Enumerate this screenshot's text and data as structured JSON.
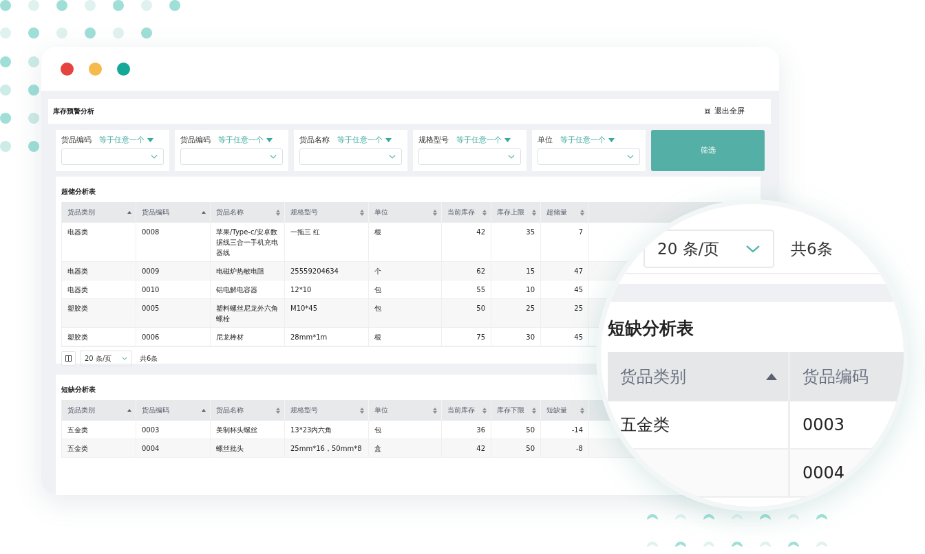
{
  "window": {
    "traffic_lights": [
      {
        "color": "#e5433f"
      },
      {
        "color": "#f6b94c"
      },
      {
        "color": "#14a898"
      }
    ]
  },
  "header": {
    "title": "库存预警分析",
    "exit_fullscreen": "退出全屏"
  },
  "filters": [
    {
      "label": "货品编码",
      "operator": "等于任意一个"
    },
    {
      "label": "货品编码",
      "operator": "等于任意一个"
    },
    {
      "label": "货品名称",
      "operator": "等于任意一个"
    },
    {
      "label": "规格型号",
      "operator": "等于任意一个"
    },
    {
      "label": "单位",
      "operator": "等于任意一个"
    }
  ],
  "filter_button": "筛选",
  "overstock": {
    "title": "超储分析表",
    "columns": [
      {
        "label": "货品类别",
        "sorted": true,
        "kind": "text"
      },
      {
        "label": "货品编码",
        "sorted": true,
        "kind": "text"
      },
      {
        "label": "货品名称",
        "sorted": false,
        "kind": "text"
      },
      {
        "label": "规格型号",
        "sorted": false,
        "kind": "text"
      },
      {
        "label": "单位",
        "sorted": false,
        "kind": "text"
      },
      {
        "label": "当前库存",
        "sorted": false,
        "kind": "number"
      },
      {
        "label": "库存上限",
        "sorted": false,
        "kind": "number"
      },
      {
        "label": "超储量",
        "sorted": false,
        "kind": "number"
      }
    ],
    "rows": [
      [
        "电器类",
        "0008",
        "苹果/Type-c/安卓数据线三合一手机充电器线",
        "一拖三 红",
        "根",
        "42",
        "35",
        "7"
      ],
      [
        "电器类",
        "0009",
        "电磁炉热敏电阻",
        "25559204634",
        "个",
        "62",
        "15",
        "47"
      ],
      [
        "电器类",
        "0010",
        "铝电解电容器",
        "12*10",
        "包",
        "55",
        "10",
        "45"
      ],
      [
        "塑胶类",
        "0005",
        "塑料螺丝尼龙外六角螺栓",
        "M10*45",
        "包",
        "50",
        "25",
        "25"
      ],
      [
        "塑胶类",
        "0006",
        "尼龙棒材",
        "28mm*1m",
        "根",
        "75",
        "30",
        "45"
      ]
    ],
    "pager": {
      "page_size": "20 条/页",
      "total": "共6条"
    }
  },
  "shortage": {
    "title": "短缺分析表",
    "columns": [
      {
        "label": "货品类别",
        "sorted": true,
        "kind": "text"
      },
      {
        "label": "货品编码",
        "sorted": true,
        "kind": "text"
      },
      {
        "label": "货品名称",
        "sorted": false,
        "kind": "text"
      },
      {
        "label": "规格型号",
        "sorted": false,
        "kind": "text"
      },
      {
        "label": "单位",
        "sorted": false,
        "kind": "text"
      },
      {
        "label": "当前库存",
        "sorted": false,
        "kind": "number"
      },
      {
        "label": "库存下限",
        "sorted": false,
        "kind": "number"
      },
      {
        "label": "短缺量",
        "sorted": false,
        "kind": "number"
      }
    ],
    "rows": [
      [
        "五金类",
        "0003",
        "美制杯头螺丝",
        "13*23内六角",
        "包",
        "36",
        "50",
        "-14"
      ],
      [
        "五金类",
        "0004",
        "螺丝批头",
        "25mm*16，50mm*8",
        "盒",
        "42",
        "50",
        "-8"
      ]
    ]
  },
  "magnifier": {
    "page_size": "20 条/页",
    "total": "共6条",
    "title": "短缺分析表",
    "columns": [
      {
        "label": "货品类别",
        "sorted": true
      },
      {
        "label": "货品编码",
        "sorted": false
      }
    ],
    "rows": [
      [
        "五金类",
        "0003"
      ],
      [
        "",
        "0004"
      ]
    ]
  }
}
